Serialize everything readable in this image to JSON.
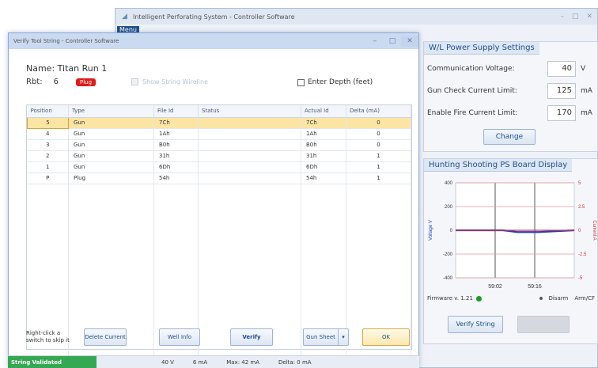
{
  "main_window": {
    "title": "Intelligent Perforating System - Controller Software",
    "menu_label": "Menu",
    "controls": [
      "–",
      "□",
      "✕"
    ]
  },
  "ws_settings": {
    "title": "W/L Power Supply Settings",
    "rows": [
      {
        "label": "Communication Voltage:",
        "value": "40",
        "unit": "V"
      },
      {
        "label": "Gun Check Current Limit:",
        "value": "125",
        "unit": "mA"
      },
      {
        "label": "Enable Fire Current Limit:",
        "value": "170",
        "unit": "mA"
      }
    ],
    "change_label": "Change"
  },
  "hunting": {
    "title": "Hunting Shooting PS Board Display",
    "firmware": "Firmware v. 1.21",
    "status_right_1": "Disarm",
    "status_right_2": "Arm/CF",
    "verify_string_label": "Verify String"
  },
  "chart_data": {
    "type": "line",
    "title": "",
    "xlabel": "",
    "ylabel_left": "Voltage V",
    "ylabel_right": "Current A",
    "x_ticks": [
      "59:02",
      "59:16"
    ],
    "y_left_ticks": [
      400,
      200,
      0,
      -200,
      -400
    ],
    "y_right_ticks": [
      5,
      2.5,
      0,
      -2.5,
      -5
    ],
    "ylim_left": [
      -400,
      400
    ],
    "ylim_right": [
      -5,
      5
    ],
    "series": [
      {
        "color": "#1f3fc4",
        "y_left_values": [
          0,
          0,
          -15,
          -15,
          0
        ]
      },
      {
        "color": "#d8343c",
        "y_left_values": [
          0,
          0,
          0,
          0,
          0
        ]
      }
    ]
  },
  "dialog": {
    "title": "Verify Tool String - Controller Software",
    "name_label": "Name:",
    "name_value": "Titan Run 1",
    "rbt_label": "Rbt:",
    "rbt_value": "6",
    "plug_badge": "Plug",
    "disabled_check_label": "Show String Wireline",
    "enter_depth_label": "Enter Depth (feet)",
    "columns": [
      "Position",
      "Type",
      "File Id",
      "Status",
      "Actual Id",
      "Delta (mA)"
    ],
    "rows": [
      {
        "position": "5",
        "type": "Gun",
        "file_id": "7Ch",
        "status": "",
        "actual_id": "7Ch",
        "delta": "0"
      },
      {
        "position": "4",
        "type": "Gun",
        "file_id": "1Ah",
        "status": "",
        "actual_id": "1Ah",
        "delta": "0"
      },
      {
        "position": "3",
        "type": "Gun",
        "file_id": "B0h",
        "status": "",
        "actual_id": "B0h",
        "delta": "0"
      },
      {
        "position": "2",
        "type": "Gun",
        "file_id": "31h",
        "status": "",
        "actual_id": "31h",
        "delta": "1"
      },
      {
        "position": "1",
        "type": "Gun",
        "file_id": "6Dh",
        "status": "",
        "actual_id": "6Dh",
        "delta": "1"
      },
      {
        "position": "P",
        "type": "Plug",
        "file_id": "54h",
        "status": "",
        "actual_id": "54h",
        "delta": "1"
      }
    ],
    "hint": "Right-click a switch to skip it",
    "buttons": {
      "delete": "Delete Current",
      "well_info": "Well Info",
      "verify": "Verify",
      "gun_sheet": "Gun Sheet",
      "ok": "OK"
    }
  },
  "statusbar": {
    "validated": "String Validated",
    "voltage": "40 V",
    "current": "6 mA",
    "max": "Max: 42 mA",
    "delta": "Delta: 0 mA"
  }
}
